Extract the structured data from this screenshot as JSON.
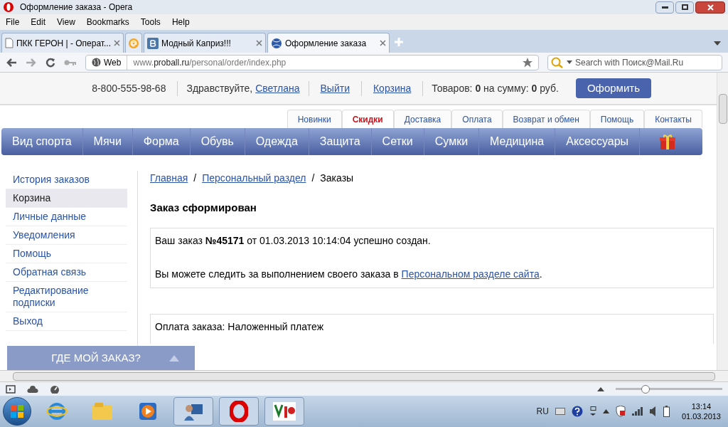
{
  "window": {
    "title": "Оформление заказа - Opera"
  },
  "menu": [
    "File",
    "Edit",
    "View",
    "Bookmarks",
    "Tools",
    "Help"
  ],
  "tabs": [
    {
      "kind": "page",
      "label": "ПКК ГЕРОН | - Операт...",
      "selected": false
    },
    {
      "kind": "iconOnly",
      "selected": false
    },
    {
      "kind": "vk",
      "label": "Модный Каприз!!!",
      "selected": false
    },
    {
      "kind": "ball",
      "label": "Оформление заказа",
      "selected": true
    }
  ],
  "address": {
    "badge": "Web",
    "host": "www.",
    "domain": "proball.ru",
    "path": "/personal/order/index.php"
  },
  "search": {
    "placeholder": "Search with Поиск@Mail.Ru"
  },
  "topbar": {
    "phone": "8-800-555-98-68",
    "greeting": "Здравствуйте,",
    "user": "Светлана",
    "logout": "Выйти",
    "cart": "Корзина",
    "summary": "Товаров: **0** на сумму: **0** руб.",
    "checkout": "Оформить"
  },
  "info_tabs": [
    {
      "label": "Новинки",
      "selected": false
    },
    {
      "label": "Скидки",
      "selected": true
    },
    {
      "label": "Доставка",
      "selected": false
    },
    {
      "label": "Оплата",
      "selected": false
    },
    {
      "label": "Возврат и обмен",
      "selected": false
    },
    {
      "label": "Помощь",
      "selected": false
    },
    {
      "label": "Контакты",
      "selected": false
    }
  ],
  "categories": [
    "Вид спорта",
    "Мячи",
    "Форма",
    "Обувь",
    "Одежда",
    "Защита",
    "Сетки",
    "Сумки",
    "Медицина",
    "Аксессуары"
  ],
  "sidebar": [
    {
      "label": "История заказов",
      "selected": false
    },
    {
      "label": "Корзина",
      "selected": true
    },
    {
      "label": "Личные данные",
      "selected": false
    },
    {
      "label": "Уведомления",
      "selected": false
    },
    {
      "label": "Помощь",
      "selected": false
    },
    {
      "label": "Обратная связь",
      "selected": false
    },
    {
      "label": "Редактирование подписки",
      "selected": false
    },
    {
      "label": "Выход",
      "selected": false
    }
  ],
  "breadcrumbs": [
    {
      "label": "Главная",
      "link": true,
      "separator": "/"
    },
    {
      "label": "Персональный раздел",
      "link": true,
      "separator": "/"
    },
    {
      "label": "Заказы",
      "link": false
    }
  ],
  "heading": "Заказ сформирован",
  "order_message": "Ваш заказ **№45171** от 01.03.2013 10:14:04 успешно создан.",
  "tracking": {
    "text": "Вы можете следить за выполнением своего заказа в",
    "link": "Персональном разделе сайта",
    "end": "."
  },
  "payment": "Оплата заказа: Наложенный платеж",
  "where_button": "ГДЕ МОЙ ЗАКАЗ?",
  "zoom": {
    "level": 0.28
  },
  "tray": {
    "lang": "RU",
    "time": "13:14",
    "date": "01.03.2013"
  },
  "taskbar": [
    {
      "kind": "ie",
      "active": false
    },
    {
      "kind": "folder",
      "active": false
    },
    {
      "kind": "media",
      "active": false
    },
    {
      "kind": "app",
      "active": true
    },
    {
      "kind": "opera",
      "active": true
    },
    {
      "kind": "vip",
      "active": true
    }
  ]
}
